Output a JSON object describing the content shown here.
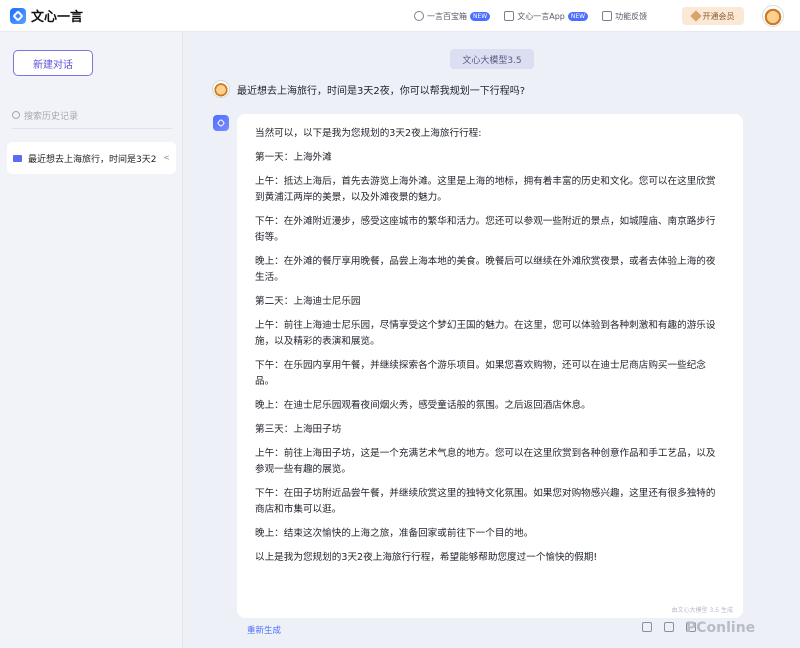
{
  "app": {
    "title": "文心一言"
  },
  "topnav": [
    {
      "label": "一言百宝箱",
      "badge": "NEW",
      "icon": "bulb-icon"
    },
    {
      "label": "文心一言App",
      "badge": "NEW",
      "icon": "phone-icon"
    },
    {
      "label": "功能反馈",
      "badge": "",
      "icon": "mail-icon"
    }
  ],
  "vip": {
    "label": "开通会员"
  },
  "sidebar": {
    "new_chat_label": "新建对话",
    "search_placeholder": "搜索历史记录",
    "history": [
      {
        "label": "最近想去上海旅行，时间是3天2"
      }
    ]
  },
  "main": {
    "model_label": "文心大模型3.5",
    "user_message": "最近想去上海旅行，时间是3天2夜，你可以帮我规划一下行程吗?",
    "answer_paragraphs": [
      "当然可以，以下是我为您规划的3天2夜上海旅行行程:",
      "第一天：上海外滩",
      "上午：抵达上海后，首先去游览上海外滩。这里是上海的地标，拥有着丰富的历史和文化。您可以在这里欣赏到黄浦江两岸的美景，以及外滩夜景的魅力。",
      "下午：在外滩附近漫步，感受这座城市的繁华和活力。您还可以参观一些附近的景点，如城隍庙、南京路步行街等。",
      "晚上：在外滩的餐厅享用晚餐，品尝上海本地的美食。晚餐后可以继续在外滩欣赏夜景，或者去体验上海的夜生活。",
      "第二天：上海迪士尼乐园",
      "上午：前往上海迪士尼乐园，尽情享受这个梦幻王国的魅力。在这里，您可以体验到各种刺激和有趣的游乐设施，以及精彩的表演和展览。",
      "下午：在乐园内享用午餐，并继续探索各个游乐项目。如果您喜欢购物，还可以在迪士尼商店购买一些纪念品。",
      "晚上：在迪士尼乐园观看夜间烟火秀，感受童话般的氛围。之后返回酒店休息。",
      "第三天：上海田子坊",
      "上午：前往上海田子坊，这是一个充满艺术气息的地方。您可以在这里欣赏到各种创意作品和手工艺品，以及参观一些有趣的展览。",
      "下午：在田子坊附近品尝午餐，并继续欣赏这里的独特文化氛围。如果您对购物感兴趣，这里还有很多独特的商店和市集可以逛。",
      "晚上：结束这次愉快的上海之旅，准备回家或前往下一个目的地。",
      "以上是我为您规划的3天2夜上海旅行行程，希望能够帮助您度过一个愉快的假期!"
    ],
    "gen_note": "由文心大模型 3.5 生成",
    "regenerate_label": "重新生成"
  },
  "watermark": "PConline"
}
